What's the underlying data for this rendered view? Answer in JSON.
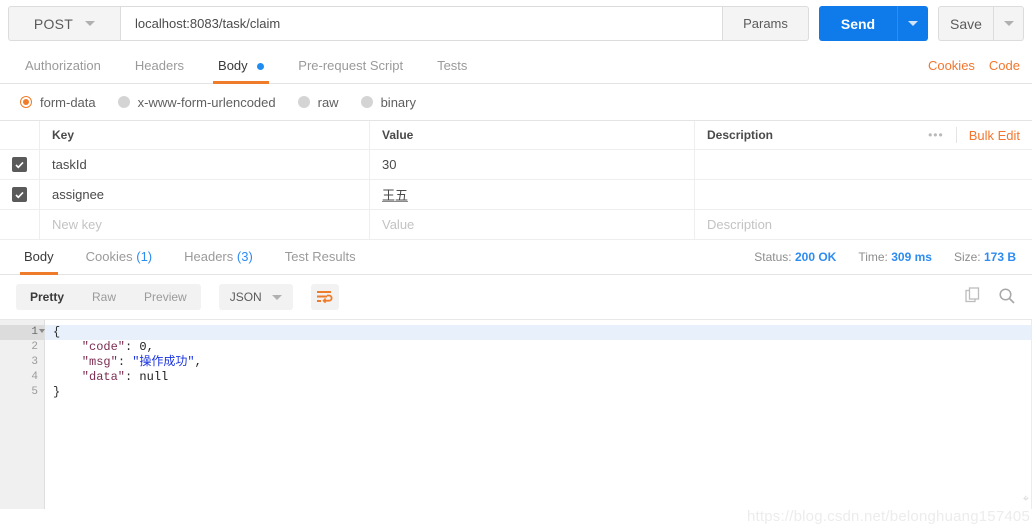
{
  "request": {
    "method": "POST",
    "url": "localhost:8083/task/claim",
    "params_label": "Params",
    "send_label": "Send",
    "save_label": "Save",
    "tabs": [
      {
        "label": "Authorization",
        "active": false,
        "dot": false
      },
      {
        "label": "Headers",
        "active": false,
        "dot": false
      },
      {
        "label": "Body",
        "active": true,
        "dot": true
      },
      {
        "label": "Pre-request Script",
        "active": false,
        "dot": false
      },
      {
        "label": "Tests",
        "active": false,
        "dot": false
      }
    ],
    "links": [
      {
        "label": "Cookies"
      },
      {
        "label": "Code"
      }
    ],
    "body_types": [
      {
        "label": "form-data",
        "selected": true
      },
      {
        "label": "x-www-form-urlencoded",
        "selected": false
      },
      {
        "label": "raw",
        "selected": false
      },
      {
        "label": "binary",
        "selected": false
      }
    ],
    "table": {
      "headers": {
        "key": "Key",
        "value": "Value",
        "description": "Description"
      },
      "bulk_edit_label": "Bulk Edit",
      "more_label": "•••",
      "rows": [
        {
          "checked": true,
          "key": "taskId",
          "value": "30",
          "description": "",
          "underline_value": false
        },
        {
          "checked": true,
          "key": "assignee",
          "value": "王五",
          "description": "",
          "underline_value": true
        }
      ],
      "new_row": {
        "key_placeholder": "New key",
        "value_placeholder": "Value",
        "desc_placeholder": "Description"
      }
    }
  },
  "response": {
    "tabs": [
      {
        "label": "Body",
        "count": "",
        "active": true
      },
      {
        "label": "Cookies",
        "count": "(1)",
        "active": false
      },
      {
        "label": "Headers",
        "count": "(3)",
        "active": false
      },
      {
        "label": "Test Results",
        "count": "",
        "active": false
      }
    ],
    "meta": {
      "status_label": "Status:",
      "status_value": "200 OK",
      "time_label": "Time:",
      "time_value": "309 ms",
      "size_label": "Size:",
      "size_value": "173 B"
    },
    "view_modes": [
      {
        "label": "Pretty",
        "active": true
      },
      {
        "label": "Raw",
        "active": false
      },
      {
        "label": "Preview",
        "active": false
      }
    ],
    "format": "JSON",
    "code_lines": [
      {
        "num": "1",
        "foldable": true,
        "highlight": true,
        "tokens": [
          {
            "t": "{",
            "c": "punc"
          }
        ]
      },
      {
        "num": "2",
        "foldable": false,
        "highlight": false,
        "tokens": [
          {
            "t": "    \"code\"",
            "c": "key"
          },
          {
            "t": ": ",
            "c": "punc"
          },
          {
            "t": "0",
            "c": "num"
          },
          {
            "t": ",",
            "c": "punc"
          }
        ]
      },
      {
        "num": "3",
        "foldable": false,
        "highlight": false,
        "tokens": [
          {
            "t": "    \"msg\"",
            "c": "key"
          },
          {
            "t": ": ",
            "c": "punc"
          },
          {
            "t": "\"操作成功\"",
            "c": "str"
          },
          {
            "t": ",",
            "c": "punc"
          }
        ]
      },
      {
        "num": "4",
        "foldable": false,
        "highlight": false,
        "tokens": [
          {
            "t": "    \"data\"",
            "c": "key"
          },
          {
            "t": ": ",
            "c": "punc"
          },
          {
            "t": "null",
            "c": "num"
          }
        ]
      },
      {
        "num": "5",
        "foldable": false,
        "highlight": false,
        "tokens": [
          {
            "t": "}",
            "c": "punc"
          }
        ]
      }
    ]
  },
  "watermark": "https://blog.csdn.net/belonghuang157405",
  "colors": {
    "accent_orange": "#ef7c2a",
    "accent_blue": "#0f7beb",
    "link_blue": "#2d8cf0",
    "key_maroon": "#7b2d52",
    "string_blue": "#1a34e0"
  }
}
